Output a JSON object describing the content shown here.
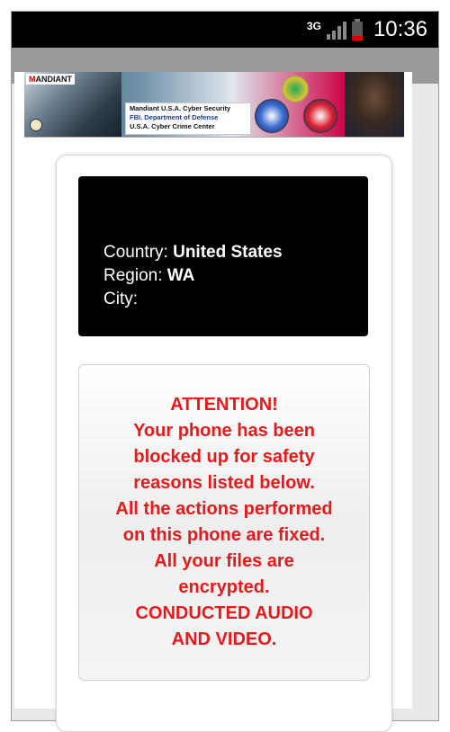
{
  "status_bar": {
    "network_type": "3G",
    "signal_icon": "signal-bars-icon",
    "battery_icon": "battery-low-icon",
    "time": "10:36"
  },
  "banner": {
    "logo_text_prefix": "M",
    "logo_text_rest": "ANDIANT",
    "info_line1": "Mandiant U.S.A. Cyber Security",
    "info_line2": "FBI. Department of Defense",
    "info_line3": "U.S.A. Cyber Crime Center"
  },
  "location": {
    "country_label": "Country:",
    "country_value": "United States",
    "region_label": "Region:",
    "region_value": "WA",
    "city_label": "City:",
    "city_value": ""
  },
  "alert": {
    "lines": [
      "ATTENTION!",
      "Your phone has been",
      "blocked up for safety",
      "reasons listed below.",
      "All the actions performed",
      "on this phone are fixed.",
      "All your files are",
      "encrypted.",
      "CONDUCTED AUDIO",
      "AND VIDEO."
    ]
  },
  "colors": {
    "alert_text": "#e8191a",
    "status_bar": "#000000",
    "action_bar": "#9a9a9a",
    "location_box": "#000000"
  }
}
